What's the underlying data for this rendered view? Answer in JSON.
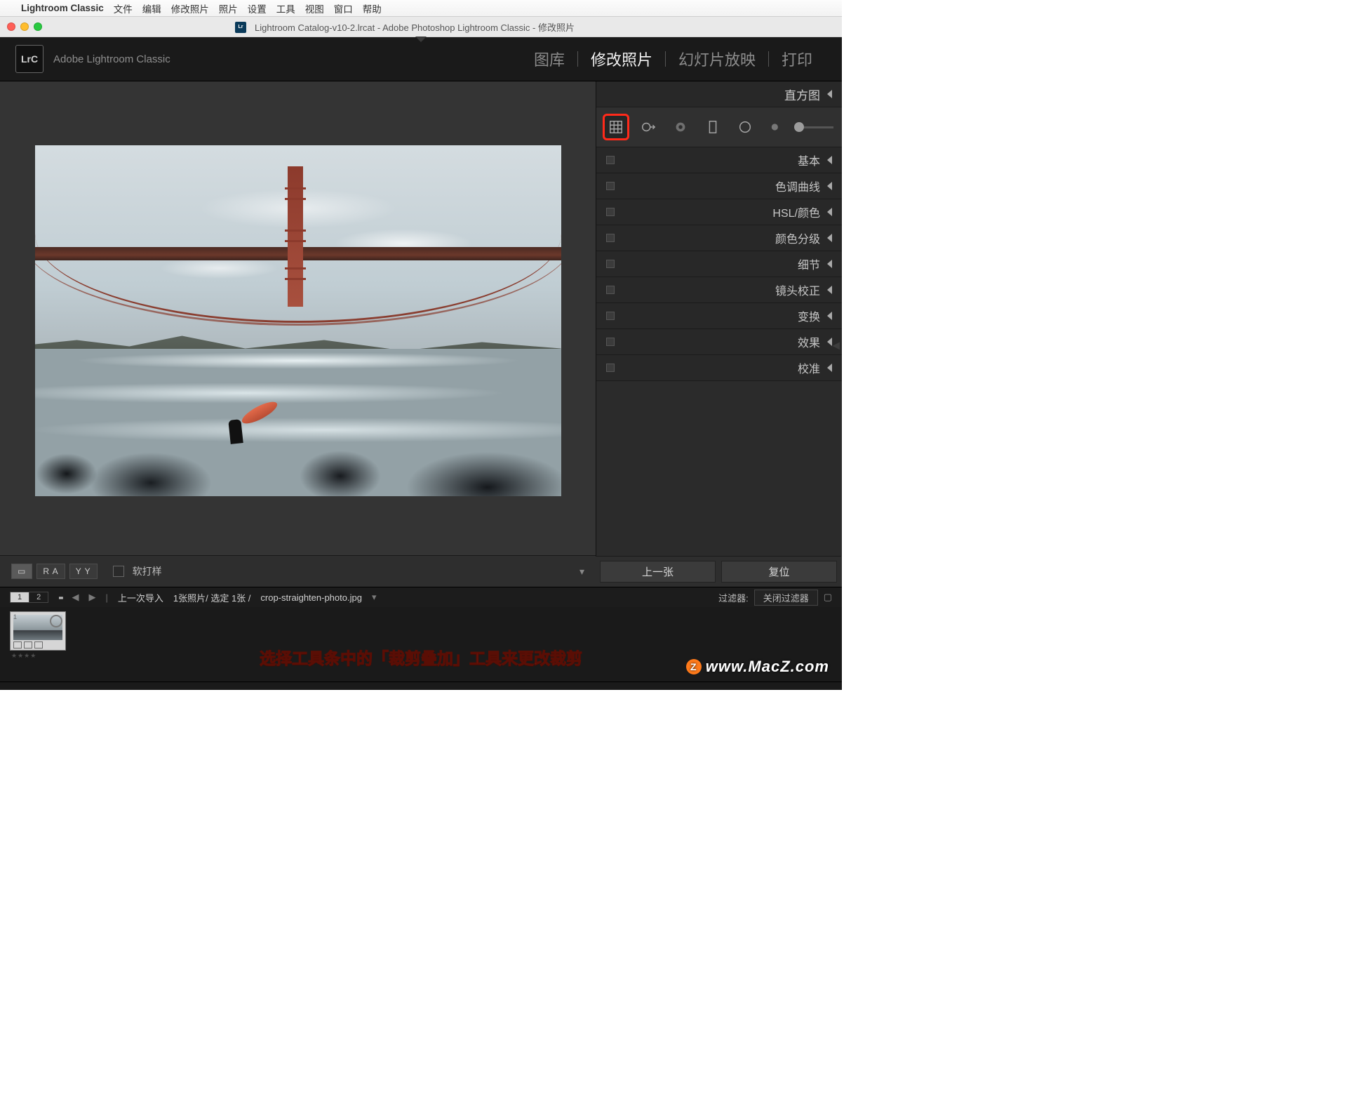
{
  "menubar": {
    "app_name": "Lightroom Classic",
    "items": [
      "文件",
      "编辑",
      "修改照片",
      "照片",
      "设置",
      "工具",
      "视图",
      "窗口",
      "帮助"
    ]
  },
  "window": {
    "title": "Lightroom Catalog-v10-2.lrcat - Adobe Photoshop Lightroom Classic - 修改照片"
  },
  "header": {
    "logo_text": "LrC",
    "subtitle": "Adobe Lightroom Classic",
    "modules": [
      {
        "label": "图库",
        "active": false
      },
      {
        "label": "修改照片",
        "active": true
      },
      {
        "label": "幻灯片放映",
        "active": false
      },
      {
        "label": "打印",
        "active": false
      }
    ]
  },
  "panel": {
    "histogram_label": "直方图",
    "tools": [
      {
        "name": "crop-overlay-tool",
        "selected": true
      },
      {
        "name": "spot-removal-tool",
        "selected": false
      },
      {
        "name": "redeye-tool",
        "selected": false
      },
      {
        "name": "graduated-filter-tool",
        "selected": false
      },
      {
        "name": "radial-filter-tool",
        "selected": false
      },
      {
        "name": "adjustment-brush-tool",
        "selected": false
      }
    ],
    "sections": [
      {
        "label": "基本"
      },
      {
        "label": "色调曲线"
      },
      {
        "label": "HSL/颜色"
      },
      {
        "label": "颜色分级"
      },
      {
        "label": "细节"
      },
      {
        "label": "镜头校正"
      },
      {
        "label": "变换"
      },
      {
        "label": "效果"
      },
      {
        "label": "校准"
      }
    ],
    "prev_label": "上一张",
    "reset_label": "复位"
  },
  "toolbar": {
    "view_modes": [
      {
        "code": "▭",
        "on": true
      },
      {
        "code": "R A",
        "on": false
      },
      {
        "code": "Y Y",
        "on": false
      }
    ],
    "soft_proof_label": "软打样"
  },
  "stripbar": {
    "monitors": [
      "1",
      "2"
    ],
    "grid_on": true,
    "crumb_parts": [
      "上一次导入",
      "1张照片/ 选定 1张 /",
      "crop-straighten-photo.jpg"
    ],
    "filter_label": "过滤器:",
    "filter_value": "关闭过滤器"
  },
  "filmstrip": {
    "thumb_index": "1",
    "thumb_rating": "★★★★"
  },
  "annotation_text": "选择工具条中的「裁剪叠加」工具来更改裁剪",
  "watermark_text": "www.MacZ.com"
}
